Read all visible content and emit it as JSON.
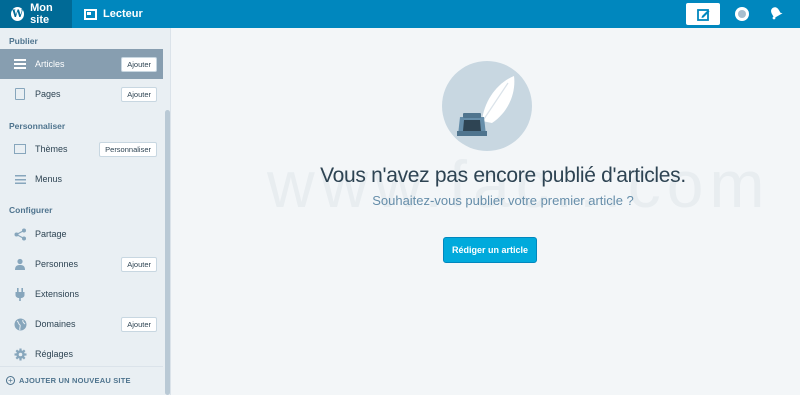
{
  "topbar": {
    "my_site": "Mon site",
    "reader": "Lecteur",
    "logo_icon": "wordpress-logo-icon",
    "write_icon": "write-icon",
    "avatar_icon": "avatar-icon",
    "notifications_icon": "notifications-icon"
  },
  "sidebar": {
    "sections": {
      "publish": "Publier",
      "personalize": "Personnaliser",
      "configure": "Configurer"
    },
    "items": [
      {
        "label": "Articles",
        "button": "Ajouter",
        "icon": "posts-icon",
        "active": true
      },
      {
        "label": "Pages",
        "button": "Ajouter",
        "icon": "pages-icon"
      },
      {
        "label": "Thèmes",
        "button": "Personnaliser",
        "icon": "themes-icon"
      },
      {
        "label": "Menus",
        "icon": "menus-icon"
      },
      {
        "label": "Partage",
        "icon": "share-icon"
      },
      {
        "label": "Personnes",
        "button": "Ajouter",
        "icon": "people-icon"
      },
      {
        "label": "Extensions",
        "icon": "plugins-icon"
      },
      {
        "label": "Domaines",
        "button": "Ajouter",
        "icon": "globe-icon"
      },
      {
        "label": "Réglages",
        "icon": "settings-icon"
      }
    ],
    "add_site": "AJOUTER UN NOUVEAU SITE"
  },
  "main": {
    "illustration_icon": "ink-and-quill-icon",
    "heading": "Vous n'avez pas encore publié d'articles.",
    "subheading": "Souhaitez-vous publier votre premier article ?",
    "cta": "Rédiger un article",
    "watermark": "www.fac...com"
  },
  "colors": {
    "topbar": "#0087be",
    "sidebar_bg": "#e9eff3",
    "active_item": "#879eb0",
    "button": "#00aadc"
  }
}
